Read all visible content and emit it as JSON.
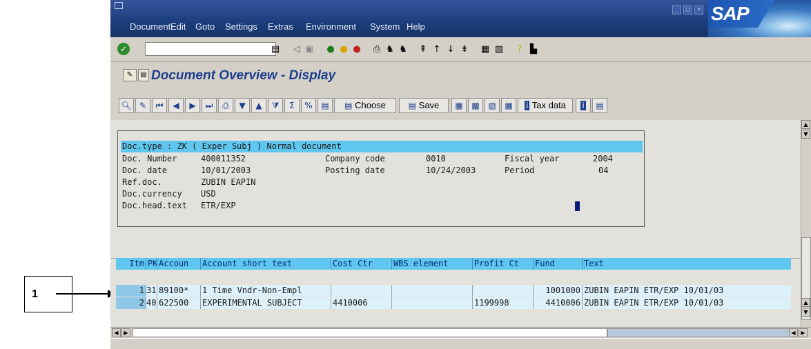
{
  "callout": {
    "number": "1"
  },
  "menu": [
    "Document",
    "Edit",
    "Goto",
    "Settings",
    "Extras",
    "Environment",
    "System",
    "Help"
  ],
  "logo": "SAP",
  "title": "Document Overview - Display",
  "toolbar": {
    "choose": "Choose",
    "save": "Save",
    "tax": "Tax data"
  },
  "header": {
    "doc_type_line": "Doc.type : ZK ( Exper Subj ) Normal document",
    "doc_number_label": "Doc. Number",
    "doc_number": "400011352",
    "company_code_label": "Company code",
    "company_code": "0010",
    "fiscal_year_label": "Fiscal year",
    "fiscal_year": "2004",
    "doc_date_label": "Doc. date",
    "doc_date": "10/01/2003",
    "posting_date_label": "Posting date",
    "posting_date": "10/24/2003",
    "period_label": "Period",
    "period": "04",
    "ref_doc_label": "Ref.doc.",
    "ref_doc": "ZUBIN EAPIN",
    "currency_label": "Doc.currency",
    "currency": "USD",
    "head_text_label": "Doc.head.text",
    "head_text": "ETR/EXP"
  },
  "table": {
    "columns": [
      "Itm",
      "PK",
      "Accoun",
      "Account short text",
      "Cost Ctr",
      "WBS element",
      "Profit Ct",
      "Fund",
      "Text"
    ],
    "rows": [
      [
        "1",
        "31",
        "89100*",
        "1 Time Vndr-Non-Empl",
        "",
        "",
        "",
        "1001000",
        "ZUBIN EAPIN ETR/EXP 10/01/03"
      ],
      [
        "2",
        "40",
        "622500",
        "EXPERIMENTAL SUBJECT",
        "4410006",
        "",
        "1199998",
        "4410006",
        "ZUBIN EAPIN ETR/EXP 10/01/03"
      ]
    ]
  }
}
